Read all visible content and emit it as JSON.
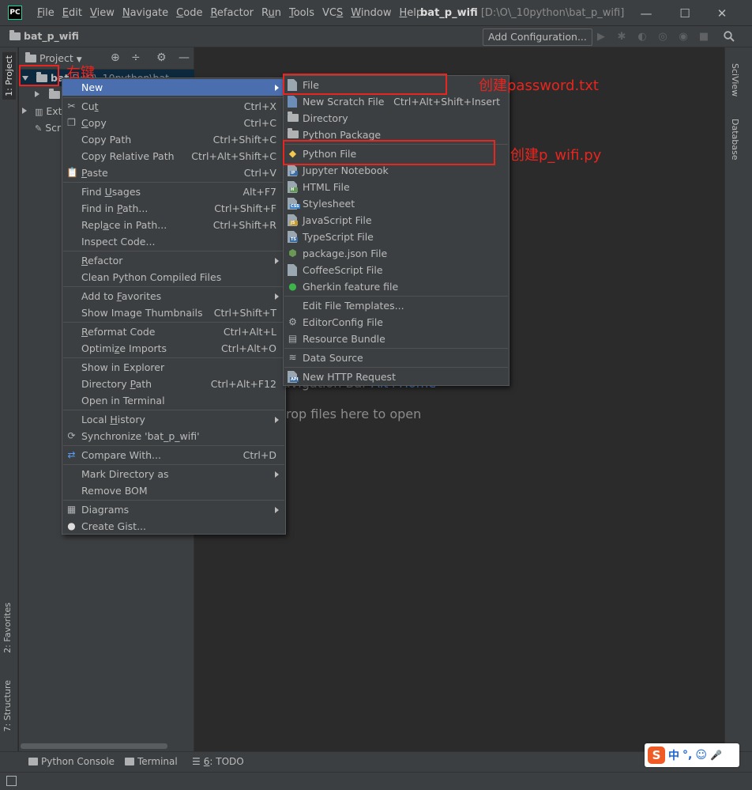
{
  "titlebar": {
    "logo": "PC",
    "menu": [
      {
        "pre": "",
        "ul": "F",
        "post": "ile"
      },
      {
        "pre": "",
        "ul": "E",
        "post": "dit"
      },
      {
        "pre": "",
        "ul": "V",
        "post": "iew"
      },
      {
        "pre": "",
        "ul": "N",
        "post": "avigate"
      },
      {
        "pre": "",
        "ul": "C",
        "post": "ode"
      },
      {
        "pre": "",
        "ul": "R",
        "post": "efactor"
      },
      {
        "pre": "R",
        "ul": "u",
        "post": "n"
      },
      {
        "pre": "",
        "ul": "T",
        "post": "ools"
      },
      {
        "pre": "VC",
        "ul": "S",
        "post": ""
      },
      {
        "pre": "",
        "ul": "W",
        "post": "indow"
      },
      {
        "pre": "",
        "ul": "H",
        "post": "elp"
      }
    ],
    "project_name": "bat_p_wifi",
    "project_path": "[D:\\O\\_10python\\bat_p_wifi]",
    "minimize": "—",
    "maximize": "☐",
    "close": "✕"
  },
  "navbar": {
    "project": "bat_p_wifi",
    "add_configuration": "Add Configuration..."
  },
  "left_tabs": {
    "project": "1: Project",
    "favorites": "2: Favorites",
    "structure": "7: Structure"
  },
  "right_tabs": {
    "sciview": "SciView",
    "database": "Database"
  },
  "project_panel": {
    "selector": "Project",
    "root": "bat",
    "root_path": "D:\\O\\_10python\\bat",
    "child1": "",
    "external": "Ext",
    "scratches": "Scr"
  },
  "editor": {
    "hint_nav_text": "avigation Bar",
    "hint_nav_key": "Alt+Home",
    "hint_drop": "rop files here to open"
  },
  "bottom_tabs": {
    "python_console": "Python Console",
    "terminal": "Terminal",
    "todo_pre": "",
    "todo_ul": "6",
    "todo_post": ": TODO"
  },
  "ime": {
    "logo": "S",
    "lang": "中",
    "punct": "°,",
    "emoji": "☺",
    "mic": "🎤"
  },
  "context_menu": {
    "new": "New",
    "cut": {
      "pre": "Cu",
      "ul": "t",
      "post": "",
      "shortcut": "Ctrl+X"
    },
    "copy": {
      "pre": "",
      "ul": "C",
      "post": "opy",
      "shortcut": "Ctrl+C"
    },
    "copy_path": {
      "label": "Copy Path",
      "shortcut": "Ctrl+Shift+C"
    },
    "copy_relative_path": {
      "label": "Copy Relative Path",
      "shortcut": "Ctrl+Alt+Shift+C"
    },
    "paste": {
      "pre": "",
      "ul": "P",
      "post": "aste",
      "shortcut": "Ctrl+V"
    },
    "find_usages": {
      "pre": "Find ",
      "ul": "U",
      "post": "sages",
      "shortcut": "Alt+F7"
    },
    "find_in_path": {
      "pre": "Find in ",
      "ul": "P",
      "post": "ath...",
      "shortcut": "Ctrl+Shift+F"
    },
    "replace_in_path": {
      "pre": "Repl",
      "ul": "a",
      "post": "ce in Path...",
      "shortcut": "Ctrl+Shift+R"
    },
    "inspect_code": {
      "label": "Inspect Code..."
    },
    "refactor": {
      "pre": "",
      "ul": "R",
      "post": "efactor"
    },
    "clean_python": {
      "label": "Clean Python Compiled Files"
    },
    "add_to_favorites": {
      "pre": "Add to ",
      "ul": "F",
      "post": "avorites"
    },
    "show_thumbnails": {
      "label": "Show Image Thumbnails",
      "shortcut": "Ctrl+Shift+T"
    },
    "reformat_code": {
      "pre": "",
      "ul": "R",
      "post": "eformat Code",
      "shortcut": "Ctrl+Alt+L"
    },
    "optimize_imports": {
      "pre": "Optimi",
      "ul": "z",
      "post": "e Imports",
      "shortcut": "Ctrl+Alt+O"
    },
    "show_in_explorer": {
      "label": "Show in Explorer"
    },
    "directory_path": {
      "pre": "Directory ",
      "ul": "P",
      "post": "ath",
      "shortcut": "Ctrl+Alt+F12"
    },
    "open_in_terminal": {
      "label": "Open in Terminal"
    },
    "local_history": {
      "pre": "Local ",
      "ul": "H",
      "post": "istory"
    },
    "synchronize": {
      "label": "Synchronize 'bat_p_wifi'"
    },
    "compare_with": {
      "label": "Compare With...",
      "shortcut": "Ctrl+D"
    },
    "mark_directory": {
      "label": "Mark Directory as"
    },
    "remove_bom": {
      "label": "Remove BOM"
    },
    "diagrams": {
      "label": "Diagrams"
    },
    "create_gist": {
      "label": "Create Gist..."
    }
  },
  "new_submenu": {
    "file": "File",
    "new_scratch_file": {
      "label": "New Scratch File",
      "shortcut": "Ctrl+Alt+Shift+Insert"
    },
    "directory": "Directory",
    "python_package": "Python Package",
    "python_file": "Python File",
    "jupyter_notebook": "Jupyter Notebook",
    "html_file": "HTML File",
    "stylesheet": "Stylesheet",
    "javascript_file": "JavaScript File",
    "typescript_file": "TypeScript File",
    "package_json": "package.json File",
    "coffeescript_file": "CoffeeScript File",
    "gherkin_file": "Gherkin feature file",
    "edit_file_templates": "Edit File Templates...",
    "editorconfig_file": "EditorConfig File",
    "resource_bundle": "Resource Bundle",
    "data_source": "Data Source",
    "new_http_request": "New HTTP Request"
  },
  "annotations": {
    "right_click": "右键",
    "create_password": "创建password.txt",
    "create_pwifi": "创建p_wifi.py"
  },
  "colors": {
    "selection": "#4b6eaf",
    "annotation_red": "#e8251f",
    "menu_bg": "#3c3f41",
    "editor_bg": "#2b2b2b"
  }
}
